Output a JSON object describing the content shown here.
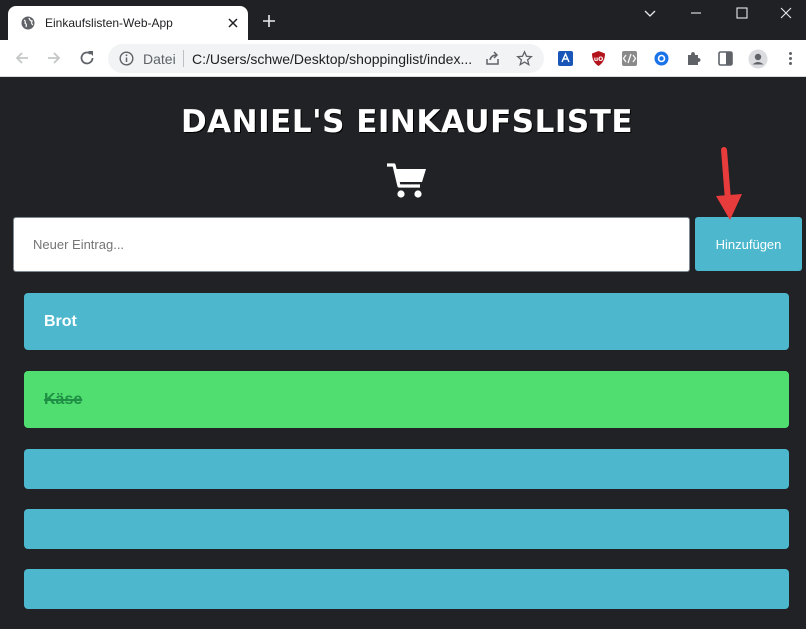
{
  "browser": {
    "tab_title": "Einkaufslisten-Web-App",
    "omnibox_scheme": "Datei",
    "omnibox_url": "C:/Users/schwe/Desktop/shoppinglist/index..."
  },
  "app": {
    "heading": "DANIEL'S EINKAUFSLISTE",
    "input_placeholder": "Neuer Eintrag...",
    "input_value": "",
    "add_button_label": "Hinzufügen",
    "items": [
      {
        "label": "Brot",
        "done": false
      },
      {
        "label": "Käse",
        "done": true
      },
      {
        "label": "",
        "done": false
      },
      {
        "label": "",
        "done": false
      },
      {
        "label": "",
        "done": false
      }
    ]
  },
  "colors": {
    "background": "#212226",
    "accent": "#4cb7cd",
    "done": "#50de70",
    "annotation_arrow": "#e83b3b"
  },
  "icons": [
    "globe-icon",
    "close-icon",
    "plus-icon",
    "back-icon",
    "forward-icon",
    "reload-icon",
    "info-icon",
    "share-icon",
    "star-icon",
    "shopping-cart-icon",
    "arrow-annotation-icon"
  ]
}
